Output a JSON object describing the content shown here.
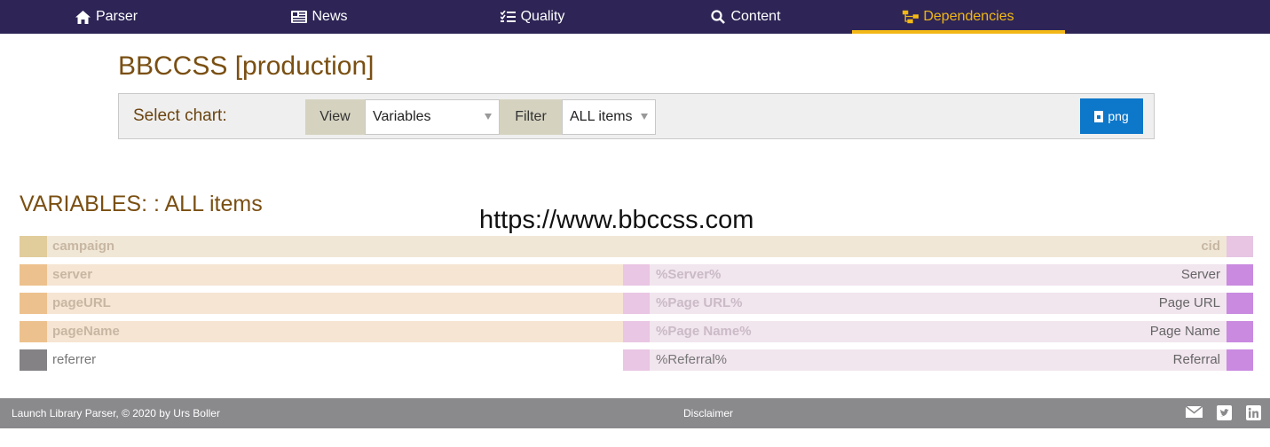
{
  "nav": {
    "items": [
      {
        "label": "Parser",
        "icon": "home-icon"
      },
      {
        "label": "News",
        "icon": "newspaper-icon"
      },
      {
        "label": "Quality",
        "icon": "checklist-icon"
      },
      {
        "label": "Content",
        "icon": "search-icon"
      },
      {
        "label": "Dependencies",
        "icon": "sitemap-icon"
      }
    ],
    "active": "Dependencies",
    "active_color": "#f2b816",
    "bg_color": "#2e2556"
  },
  "page": {
    "title": "BBCCSS [production]"
  },
  "chart_select": {
    "label": "Select chart:",
    "view_label": "View",
    "view_value": "Variables",
    "filter_label": "Filter",
    "filter_value": "ALL items",
    "png_label": "png"
  },
  "chart": {
    "heading": "VARIABLES: : ALL items",
    "watermark": "https://www.bbccss.com",
    "rows": [
      {
        "left": "campaign",
        "middle": "",
        "right": "cid"
      },
      {
        "left": "server",
        "middle": "%Server%",
        "right": "Server"
      },
      {
        "left": "pageURL",
        "middle": "%Page URL%",
        "right": "Page URL"
      },
      {
        "left": "pageName",
        "middle": "%Page Name%",
        "right": "Page Name"
      },
      {
        "left": "referrer",
        "middle": "%Referral%",
        "right": "Referral"
      }
    ]
  },
  "footer": {
    "copyright": "Launch Library Parser, © 2020 by Urs Boller",
    "disclaimer": "Disclaimer",
    "icons": [
      "envelope-icon",
      "twitter-icon",
      "linkedin-icon"
    ]
  }
}
